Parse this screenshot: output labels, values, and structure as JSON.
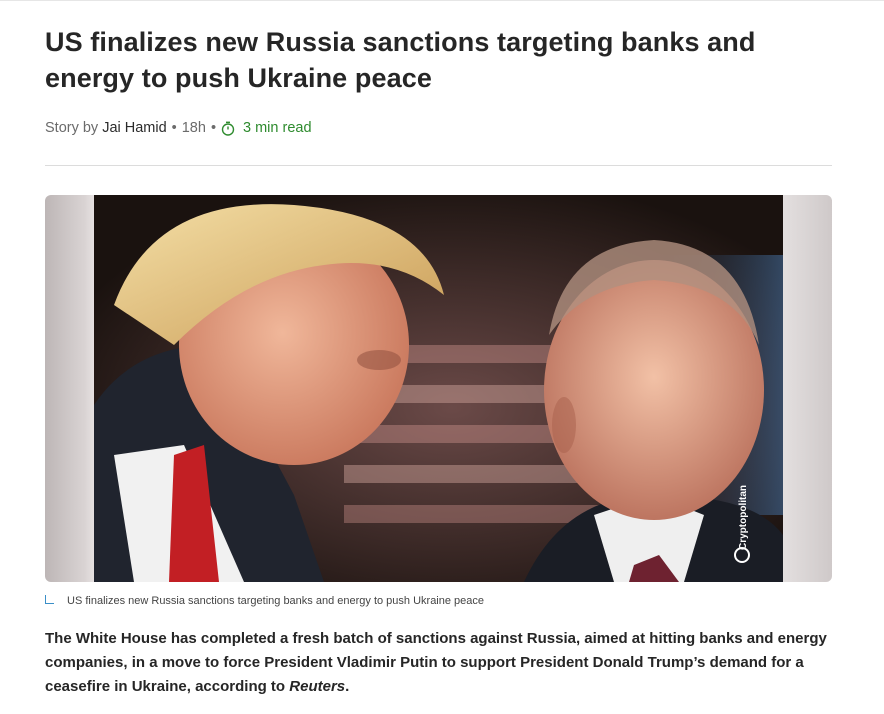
{
  "article": {
    "headline": "US finalizes new Russia sanctions targeting banks and energy to push Ukraine peace",
    "byline": {
      "prefix": "Story by",
      "author": "Jai Hamid",
      "age": "18h",
      "read_time": "3 min read",
      "read_icon": "timer-icon"
    },
    "hero_image": {
      "alt": "Trump and Putin",
      "watermark": "Cryptopolitan"
    },
    "caption": "US finalizes new Russia sanctions targeting banks and energy to push Ukraine peace",
    "lede": {
      "text": "The White House has completed a fresh batch of sanctions against Russia, aimed at hitting banks and energy companies, in a move to force President Vladimir Putin to support President Donald Trump’s demand for a ceasefire in Ukraine, according to ",
      "source": "Reuters",
      "end": "."
    }
  },
  "colors": {
    "accent_green": "#2e8b2e",
    "caption_marker": "#3a8fc8"
  }
}
